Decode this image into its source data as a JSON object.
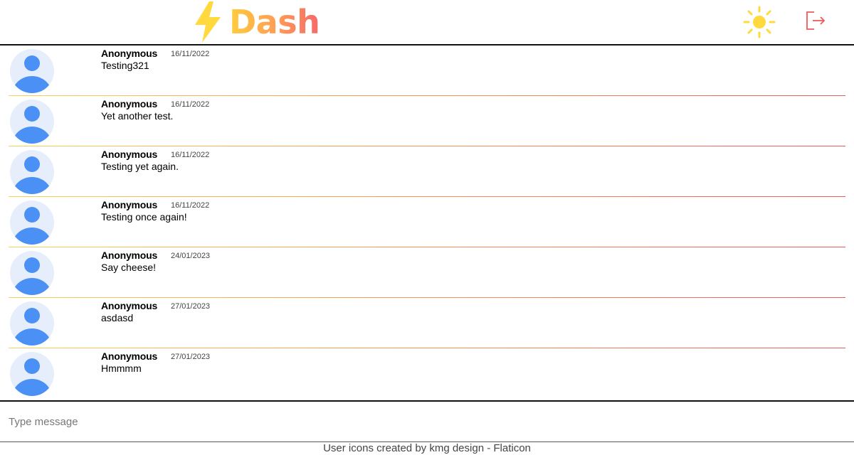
{
  "app": {
    "title": "Dash",
    "brand_gradient": [
      "#ffce3d",
      "#ff9a55",
      "#f46a6a"
    ],
    "bolt_color": "#ffd93d",
    "sun_color": "#ffd93d",
    "logout_color": "#f05a5a",
    "avatar_bg": "#e6edfb",
    "avatar_fg": "#4a90f5"
  },
  "header": {
    "logo_icon": "lightning-bolt-icon",
    "theme_icon": "sun-icon",
    "logout_icon": "logout-icon"
  },
  "messages": [
    {
      "author": "Anonymous",
      "date": "16/11/2022",
      "text": "Testing321"
    },
    {
      "author": "Anonymous",
      "date": "16/11/2022",
      "text": "Yet another test."
    },
    {
      "author": "Anonymous",
      "date": "16/11/2022",
      "text": "Testing yet again."
    },
    {
      "author": "Anonymous",
      "date": "16/11/2022",
      "text": "Testing once again!"
    },
    {
      "author": "Anonymous",
      "date": "24/01/2023",
      "text": "Say cheese!"
    },
    {
      "author": "Anonymous",
      "date": "27/01/2023",
      "text": "asdasd"
    },
    {
      "author": "Anonymous",
      "date": "27/01/2023",
      "text": "Hmmmm"
    }
  ],
  "compose": {
    "placeholder": "Type message",
    "value": ""
  },
  "footer": {
    "credit": "User icons created by kmg design - Flaticon"
  }
}
